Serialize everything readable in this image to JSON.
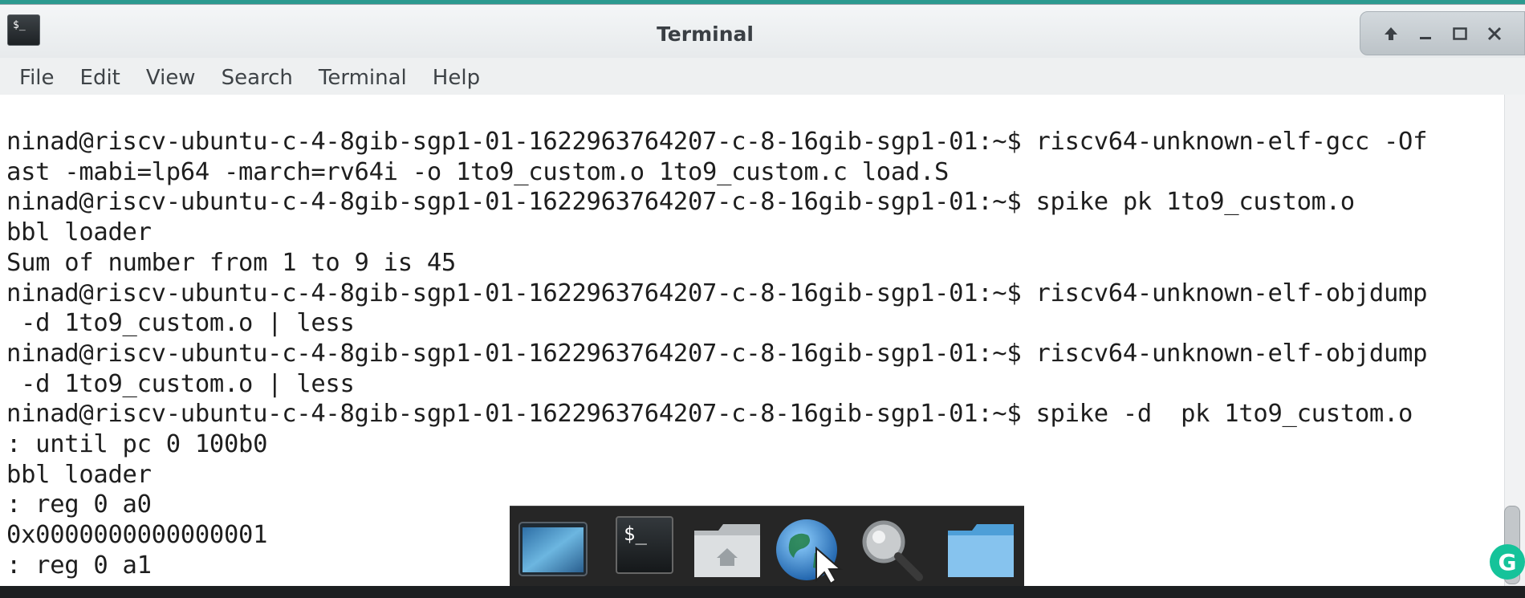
{
  "window": {
    "title": "Terminal",
    "app_icon_text": "$_",
    "controls": [
      "up-arrow",
      "minimize",
      "maximize",
      "close"
    ]
  },
  "menu": {
    "items": [
      "File",
      "Edit",
      "View",
      "Search",
      "Terminal",
      "Help"
    ]
  },
  "terminal": {
    "lines": [
      "ninad@riscv-ubuntu-c-4-8gib-sgp1-01-1622963764207-c-8-16gib-sgp1-01:~$ riscv64-unknown-elf-gcc -Of",
      "ast -mabi=lp64 -march=rv64i -o 1to9_custom.o 1to9_custom.c load.S",
      "ninad@riscv-ubuntu-c-4-8gib-sgp1-01-1622963764207-c-8-16gib-sgp1-01:~$ spike pk 1to9_custom.o",
      "bbl loader",
      "Sum of number from 1 to 9 is 45",
      "ninad@riscv-ubuntu-c-4-8gib-sgp1-01-1622963764207-c-8-16gib-sgp1-01:~$ riscv64-unknown-elf-objdump",
      " -d 1to9_custom.o | less",
      "ninad@riscv-ubuntu-c-4-8gib-sgp1-01-1622963764207-c-8-16gib-sgp1-01:~$ riscv64-unknown-elf-objdump",
      " -d 1to9_custom.o | less",
      "ninad@riscv-ubuntu-c-4-8gib-sgp1-01-1622963764207-c-8-16gib-sgp1-01:~$ spike -d  pk 1to9_custom.o",
      ": until pc 0 100b0",
      "bbl loader",
      ": reg 0 a0",
      "0x0000000000000001",
      ": reg 0 a1"
    ]
  },
  "dock": {
    "items": [
      "show-desktop",
      "terminal",
      "home-folder",
      "web-browser",
      "search",
      "folder"
    ],
    "terminal_icon_text": "$_"
  },
  "grammarly_badge": "G",
  "colors": {
    "desktop": "#2c9a8f",
    "terminal_bg": "#ffffff",
    "text": "#1e1e1e",
    "dock_bg": "#262626"
  }
}
